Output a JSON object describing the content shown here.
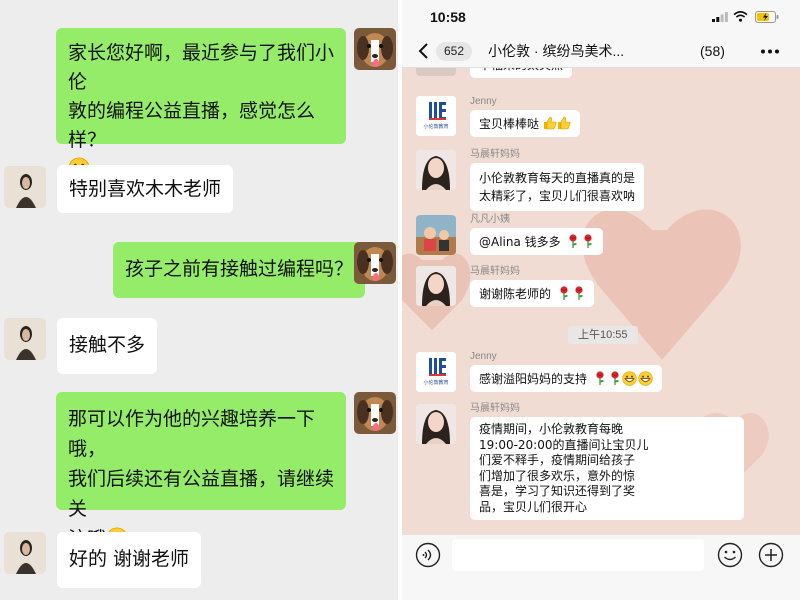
{
  "left_chat": {
    "messages": [
      {
        "side": "right",
        "text_lines": [
          "家长您好啊，最近参与了我们小伦",
          "敦的编程公益直播，感觉怎么样？"
        ],
        "trailing_emoji": "grinning-face-icon"
      },
      {
        "side": "left",
        "text": "特别喜欢木木老师"
      },
      {
        "side": "right",
        "text": "孩子之前有接触过编程吗？"
      },
      {
        "side": "left",
        "text": "接触不多"
      },
      {
        "side": "right",
        "text_lines": [
          "那可以作为他的兴趣培养一下哦，",
          "我们后续还有公益直播，请继续关",
          "注哦"
        ],
        "trailing_emoji": "grinning-face-icon"
      },
      {
        "side": "left",
        "text": "好的 谢谢老师"
      }
    ]
  },
  "right_chat": {
    "status_time": "10:58",
    "back_count": "652",
    "title": "小伦敦 · 缤纷鸟美术...",
    "member_count": "(58)",
    "partial_top_text": "幸福来的太突然",
    "messages": [
      {
        "sender": "Jenny",
        "text": "宝贝棒棒哒",
        "emojis": [
          "thumbs-up-icon",
          "thumbs-up-icon"
        ]
      },
      {
        "sender": "马晨轩妈妈",
        "text_lines": [
          "小伦敦教育每天的直播真的是",
          "太精彩了，宝贝儿们很喜欢呐"
        ]
      },
      {
        "sender": "凡凡小姨",
        "text": "@Alina 钱多多",
        "emojis": [
          "rose-icon",
          "rose-icon"
        ]
      },
      {
        "sender": "马晨轩妈妈",
        "text": "谢谢陈老师的",
        "emojis": [
          "rose-icon",
          "rose-icon"
        ]
      },
      {
        "sender": "Jenny",
        "text": "感谢溢阳妈妈的支持",
        "emojis": [
          "rose-icon",
          "rose-icon",
          "grinning-face-icon",
          "grinning-face-icon"
        ]
      },
      {
        "sender": "马晨轩妈妈",
        "text_lines": [
          "疫情期间，小伦敦教育每晚",
          "19:00-20:00的直播间让宝贝儿",
          "们爱不释手，疫情期间给孩子",
          "们增加了很多欢乐，意外的惊",
          "喜是，学习了知识还得到了奖",
          "品，宝贝儿们很开心"
        ]
      }
    ],
    "time_divider": "上午10:55",
    "input_placeholder": "",
    "logo_caption": "小伦敦教育"
  },
  "colors": {
    "sent_bubble": "#95ec69",
    "received_bubble": "#ffffff",
    "left_background": "#ededed",
    "right_background": "#f2dcd5",
    "logo_blue": "#1f4e9b"
  }
}
